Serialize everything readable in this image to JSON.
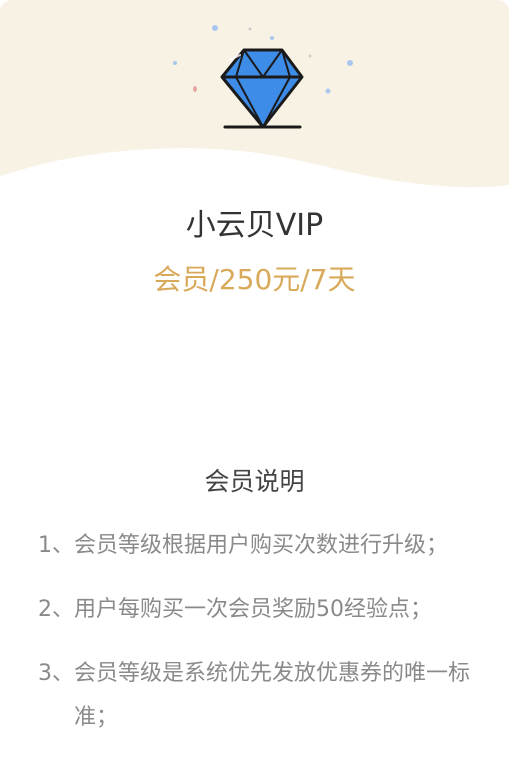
{
  "product": {
    "name": "小云贝VIP",
    "price_line": "会员/250元/7天"
  },
  "description": {
    "title": "会员说明",
    "rules": [
      {
        "num": "1、",
        "text": "会员等级根据用户购买次数进行升级；"
      },
      {
        "num": "2、",
        "text": "用户每购买一次会员奖励50经验点；"
      },
      {
        "num": "3、",
        "text": "会员等级是系统优先发放优惠券的唯一标准；"
      }
    ]
  },
  "colors": {
    "hero_bg": "#f8f2e5",
    "price": "#d9a95a",
    "diamond": "#3d8ce8"
  },
  "icons": [
    "diamond-icon"
  ]
}
